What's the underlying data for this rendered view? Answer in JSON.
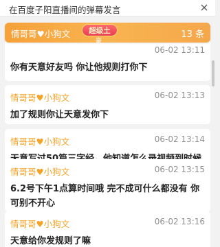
{
  "window": {
    "title": "在百度子阳直播间的弹幕发言"
  },
  "pinned": {
    "user": "情哥哥♥小狗文",
    "badge": "超级土",
    "badge_sub": "豪",
    "count": "13 条"
  },
  "partial": {
    "user": "情哥哥♥小狗文",
    "time": "06-02 13:11"
  },
  "messages": [
    {
      "user": "情哥哥♥小狗文",
      "time": "06-02 13:11",
      "text": "你有天意好友吗 你让他规则打你下"
    },
    {
      "user": "情哥哥♥小狗文",
      "time": "06-02 13:13",
      "text": "加了规则你让天意发你下"
    },
    {
      "user": "情哥哥♥小狗文",
      "time": "06-02 13:14",
      "text": "天意写过50篇三字经，他知道怎么录视频到时候给我看"
    },
    {
      "user": "情哥哥♥小狗文",
      "time": "06-02 13:15",
      "text": "6.2号下午1点算时间哦 完不成可什么都没有 你可别不开心"
    },
    {
      "user": "情哥哥♥小狗文",
      "time": "06-02 13:16",
      "text": "天意给你发规则了嘛"
    }
  ],
  "colors": {
    "accent": "#f4a327",
    "banner": "#f6a13a",
    "heart": "#ef5b7e"
  }
}
